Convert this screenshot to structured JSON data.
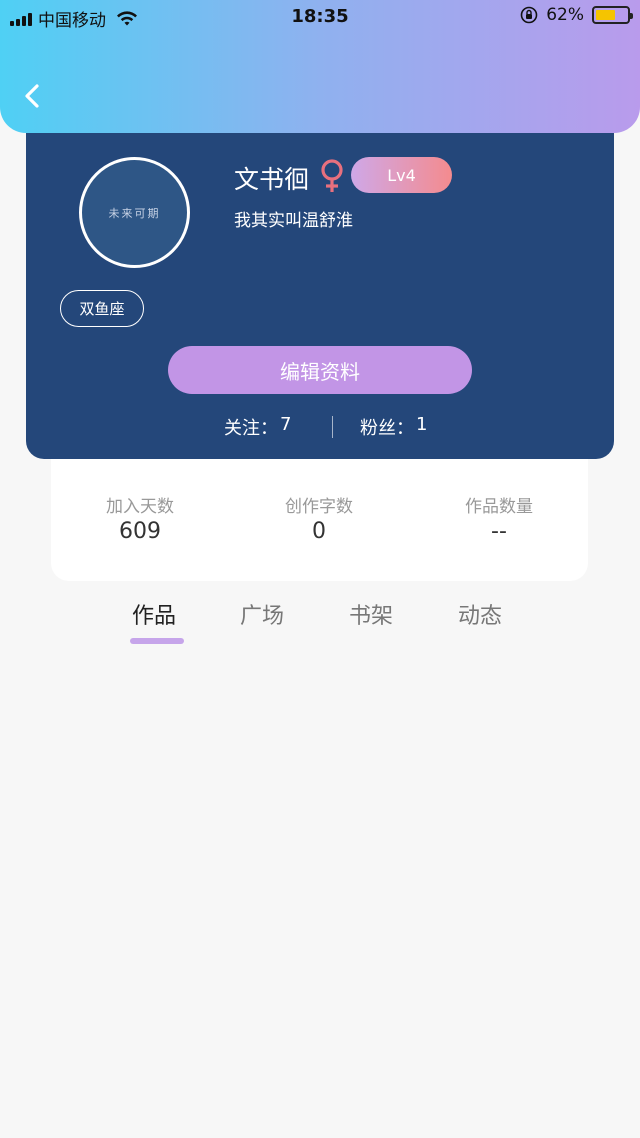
{
  "status_bar": {
    "carrier": "中国移动",
    "time": "18:35",
    "battery_percent": "62%",
    "battery_level": 0.62,
    "signal_icon": "signal-bars-icon",
    "wifi_icon": "wifi-icon",
    "orientation_lock_icon": "rotation-lock-icon"
  },
  "nav": {
    "back_icon": "chevron-left-icon"
  },
  "profile": {
    "name": "文书徊",
    "gender_symbol": "♀",
    "level": "Lv4",
    "bio": "我其实叫温舒淮",
    "avatar_text": "未来可期",
    "zodiac": "双鱼座",
    "edit_button": "编辑资料",
    "following_label": "关注：",
    "following_count": "7",
    "followers_label": "粉丝：",
    "followers_count": "1"
  },
  "stats": [
    {
      "label": "加入天数",
      "value": "609"
    },
    {
      "label": "创作字数",
      "value": "0"
    },
    {
      "label": "作品数量",
      "value": "--"
    }
  ],
  "tabs": [
    {
      "label": "作品",
      "active": true
    },
    {
      "label": "广场",
      "active": false
    },
    {
      "label": "书架",
      "active": false
    },
    {
      "label": "动态",
      "active": false
    }
  ],
  "colors": {
    "header_gradient_start": "#4fd0f4",
    "header_gradient_end": "#b99bec",
    "profile_card_bg": "#24477a",
    "accent_purple": "#c295e6",
    "gender_pink": "#e8707e"
  }
}
